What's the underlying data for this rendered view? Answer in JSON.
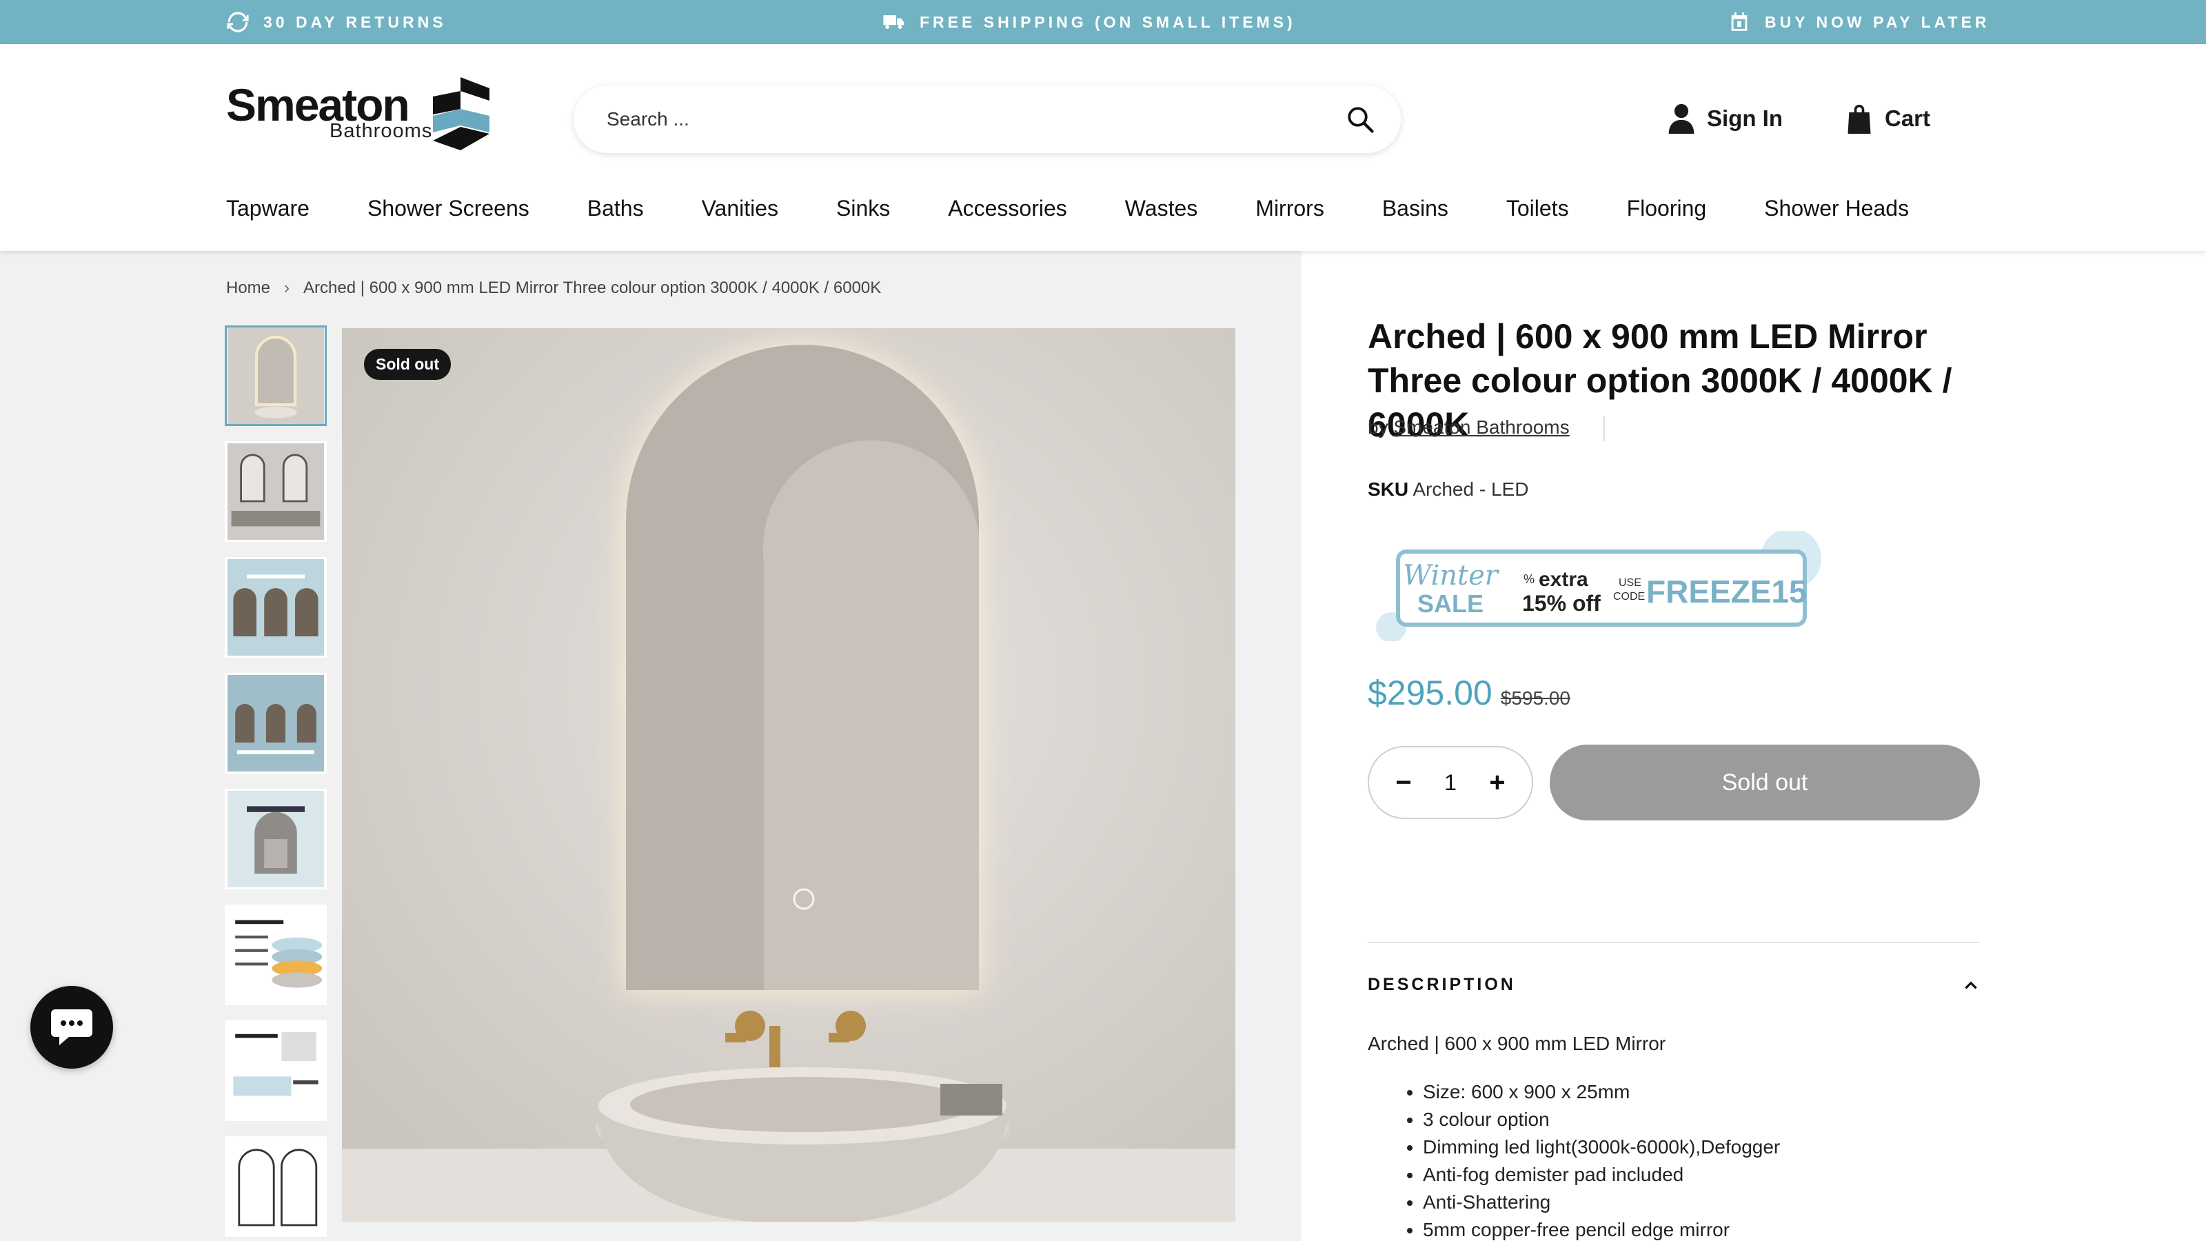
{
  "announcements": [
    {
      "icon": "refresh-icon",
      "text": "30 DAY RETURNS"
    },
    {
      "icon": "truck-icon",
      "text": "FREE SHIPPING (ON SMALL ITEMS)"
    },
    {
      "icon": "calendar-icon",
      "text": "BUY NOW PAY LATER"
    }
  ],
  "header": {
    "logo": {
      "word": "Smeaton",
      "sub": "Bathrooms"
    },
    "search": {
      "placeholder": "Search ..."
    },
    "sign_in": "Sign In",
    "cart": "Cart"
  },
  "nav": [
    "Tapware",
    "Shower Screens",
    "Baths",
    "Vanities",
    "Sinks",
    "Accessories",
    "Wastes",
    "Mirrors",
    "Basins",
    "Toilets",
    "Flooring",
    "Shower Heads"
  ],
  "breadcrumb": {
    "home": "Home",
    "current": "Arched | 600 x 900 mm LED Mirror Three colour option 3000K / 4000K / 6000K"
  },
  "gallery": {
    "badge": "Sold out",
    "thumb_count": 8
  },
  "product": {
    "title": "Arched | 600 x 900 mm LED Mirror Three colour option 3000K / 4000K / 6000K",
    "vendor_prefix": "by",
    "vendor": "Smeaton Bathrooms",
    "sku_label": "SKU",
    "sku": "Arched - LED",
    "banner": {
      "winter": "Winter",
      "sale": "SALE",
      "pct": "%",
      "extra": "extra",
      "off": "15% off",
      "use": "USE",
      "code_label": "CODE",
      "code": "FREEZE15"
    },
    "price": "$295.00",
    "compare_price": "$595.00",
    "quantity": "1",
    "button": "Sold out",
    "colors": {
      "price": "#4fa3bb",
      "accent": "#72b3c3",
      "sold_button": "#9b9b9b"
    }
  },
  "description": {
    "heading": "DESCRIPTION",
    "intro": "Arched | 600 x 900 mm LED Mirror",
    "bullets": [
      "Size: 600 x 900 x 25mm",
      "3 colour option",
      "Dimming led light(3000k-6000k),Defogger",
      "Anti-fog demister pad included",
      "Anti-Shattering",
      "5mm copper-free pencil edge mirror"
    ]
  }
}
